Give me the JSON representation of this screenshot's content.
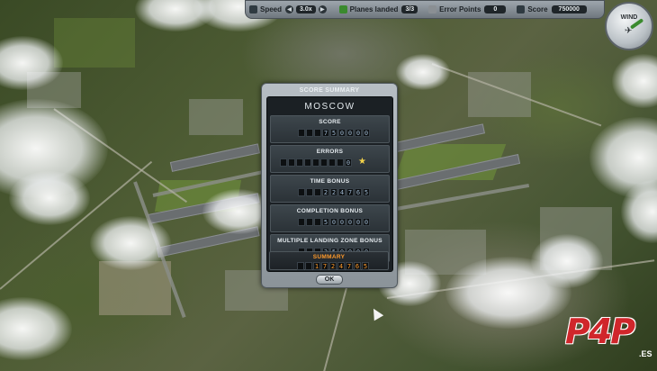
{
  "hud": {
    "speed_label": "Speed",
    "speed_value": "3.0x",
    "planes_label": "Planes landed",
    "planes_value": "3/3",
    "errors_label": "Error Points",
    "errors_value": "0",
    "score_label": "Score",
    "score_value": "750000"
  },
  "wind": {
    "label": "WIND"
  },
  "dialog": {
    "title": "SCORE SUMMARY",
    "city": "MOSCOW",
    "sections": [
      {
        "label": "SCORE",
        "value": "750000"
      },
      {
        "label": "ERRORS",
        "value": "0"
      },
      {
        "label": "TIME BONUS",
        "value": "224765"
      },
      {
        "label": "COMPLETION BONUS",
        "value": "500000"
      },
      {
        "label": "MULTIPLE LANDING ZONE BONUS",
        "value": "250000"
      },
      {
        "label": "SUMMARY",
        "value": "1724765"
      }
    ],
    "ok_label": "OK"
  },
  "watermark": {
    "brand": "P4P",
    "suffix": ".ES"
  },
  "colors": {
    "summary_accent": "#ff9a2a",
    "star": "#f3d24a",
    "watermark": "#d0262b"
  }
}
